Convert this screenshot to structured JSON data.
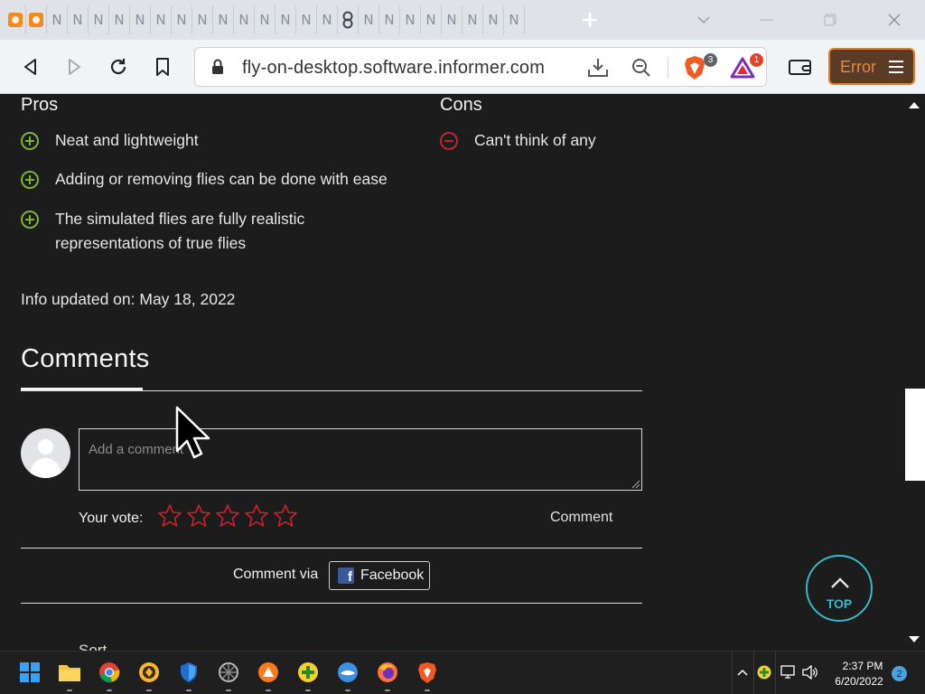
{
  "browser": {
    "url": "fly-on-desktop.software.informer.com",
    "tab_glyph": "N",
    "new_tab_glyph": "+",
    "brave_shields_count": "3",
    "rewards_count": "1",
    "error_label": "Error"
  },
  "pros": {
    "title": "Pros",
    "items": [
      "Neat and lightweight",
      "Adding or removing flies can be done with ease",
      "The simulated flies are fully realistic representations of true flies"
    ]
  },
  "cons": {
    "title": "Cons",
    "items": [
      "Can't think of any"
    ]
  },
  "info_updated": "Info updated on: May 18, 2022",
  "comments": {
    "title": "Comments",
    "placeholder": "Add a comment",
    "vote_label": "Your vote:",
    "star_count": 5,
    "comment_button": "Comment",
    "comment_via": "Comment via",
    "facebook_label": "Facebook",
    "fb_glyph": "f",
    "next_heading_fragment": "Sort"
  },
  "top_button": "TOP",
  "taskbar": {
    "apps": [
      "windows-start",
      "file-explorer",
      "chrome",
      "avast-secure-browser",
      "windows-security",
      "game-app",
      "avast-browser",
      "plus-app",
      "tag-app",
      "firefox",
      "brave"
    ],
    "time": "2:37 PM",
    "date": "6/20/2022",
    "notifications": "2"
  },
  "colors": {
    "page_bg": "#1c1c1c",
    "pro_green": "#7bb33a",
    "con_red": "#c0242b",
    "star_red": "#d0202a",
    "top_teal": "#38b8c8",
    "error_orange": "#e67c1e"
  }
}
